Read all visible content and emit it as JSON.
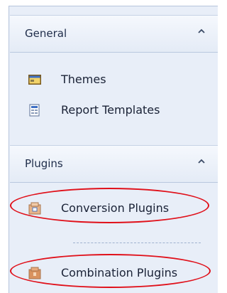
{
  "groups": [
    {
      "title": "General",
      "items": [
        {
          "label": "Themes",
          "icon": "themes-icon"
        },
        {
          "label": "Report Templates",
          "icon": "report-templates-icon"
        }
      ]
    },
    {
      "title": "Plugins",
      "items": [
        {
          "label": "Conversion Plugins",
          "icon": "conversion-plugin-icon",
          "highlighted": true
        },
        {
          "label": "Combination Plugins",
          "icon": "combination-plugin-icon",
          "highlighted": true
        }
      ]
    }
  ],
  "colors": {
    "panel_bg": "#e8eef8",
    "header_text": "#1f2d4a",
    "highlight": "#e0101a"
  }
}
